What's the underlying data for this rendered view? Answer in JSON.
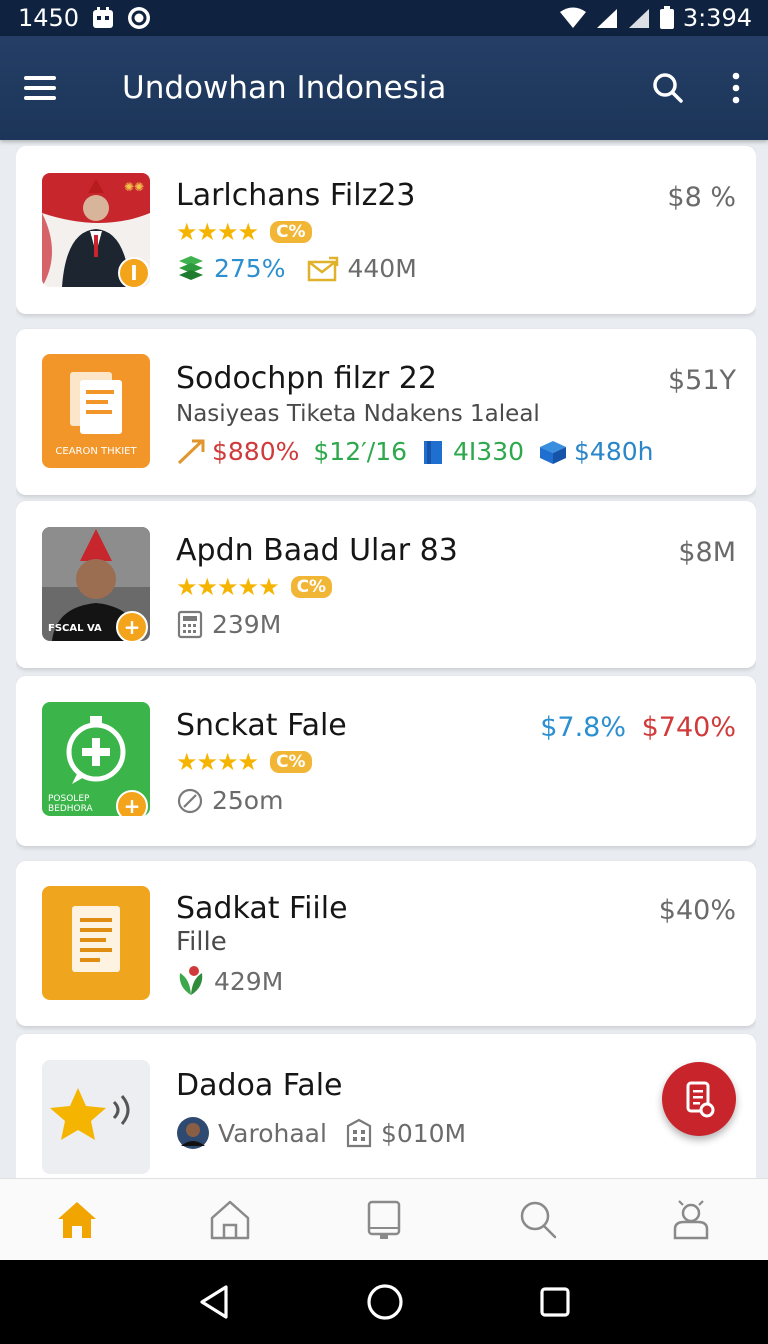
{
  "status_bar": {
    "time_left": "1450",
    "time_right": "3:394"
  },
  "app_bar": {
    "title": "Undowhan Indonesia"
  },
  "items": [
    {
      "name": "Larlchans Filz23",
      "price": "$8 %",
      "rating_badge": "C%",
      "stat1": "275%",
      "stat2": "440M",
      "thumb_badge": "I"
    },
    {
      "name": "Sodochpn filzr 22",
      "price": "$51Y",
      "subtitle": "Nasiyeas Tiketa Ndakens 1aleal",
      "thumb_text": "CEARON THKIET",
      "stat1": "$880%",
      "stat2": "$12′/16",
      "stat3": "4I330",
      "stat4": "$480h"
    },
    {
      "name": "Apdn Baad Ular 83",
      "price": "$8M",
      "rating_badge": "C%",
      "stat1": "239M",
      "thumb_text": "FSCAL VA",
      "thumb_badge": "+"
    },
    {
      "name": "Snckat Fale",
      "price": "$7.8%",
      "price2": "$740%",
      "rating_badge": "C%",
      "stat1": "25om",
      "thumb_text": "POSOLEP BEDHORA",
      "thumb_badge": "+"
    },
    {
      "name": "Sadkat Fiile",
      "price": "$40%",
      "subtitle": "Fille",
      "stat1": "429M"
    },
    {
      "name": "Dadoa Fale",
      "author": "Varohaal",
      "stat1": "$010M"
    }
  ],
  "colors": {
    "appbar": "#1f3a5f",
    "accent": "#f5b400",
    "fab": "#c8242c",
    "nav_active": "#f0a500"
  }
}
